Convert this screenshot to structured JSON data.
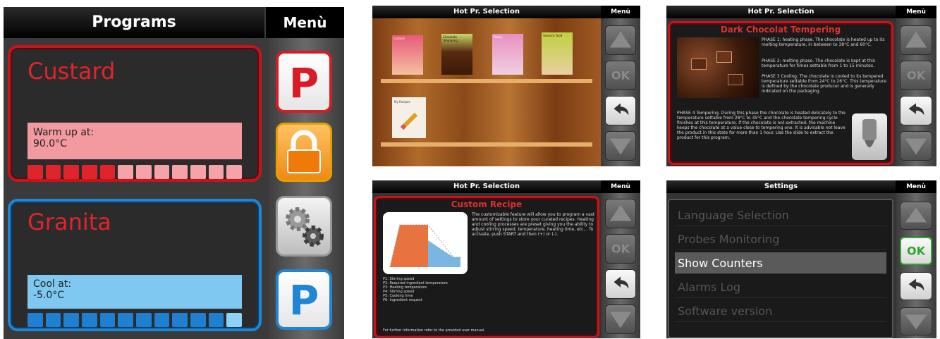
{
  "programs_screen": {
    "title": "Programs",
    "menu_title": "Menù",
    "cards": [
      {
        "name": "Custard",
        "status_label": "Warm up at:",
        "temperature": "90.0°C",
        "color": "#c8131a",
        "progress_filled": 5,
        "progress_total": 12
      },
      {
        "name": "Granita",
        "status_label": "Cool at:",
        "temperature": "-5.0°C",
        "color": "#1f86d6",
        "progress_filled": 11,
        "progress_total": 12
      }
    ],
    "menu_buttons": [
      {
        "icon": "p-icon",
        "label": "P",
        "color": "#d81b24"
      },
      {
        "icon": "lock-icon",
        "label": "",
        "color": "#f08a10"
      },
      {
        "icon": "gears-icon",
        "label": "",
        "color": "#888888"
      },
      {
        "icon": "p-icon",
        "label": "P",
        "color": "#1f86d6"
      }
    ]
  },
  "shelf_screen": {
    "title": "Hot Pr. Selection",
    "menu_title": "Menù",
    "books": [
      "Custard",
      "Chocolate Tempering",
      "Pastry",
      "Savoury Food",
      "My Recipes"
    ],
    "nav_buttons": [
      "up-arrow-icon",
      "OK",
      "back-arrow-icon",
      "down-arrow-icon"
    ]
  },
  "chocolate_screen": {
    "title": "Hot Pr. Selection",
    "menu_title": "Menù",
    "recipe_title": "Dark Chocolat Tempering",
    "phase1": "PHASE 1: heating phase. The chocolate is heated up to its melting temperature, in between to 38°C and 60°C.",
    "phase2": "PHASE 2: melting phase. The chocolate is kept at this temperature for times settable from 1 to 15 minutes.",
    "phase3": "PHASE 3 Cooling. The chocolate is cooled to its tempered temperature settable from 24°C to 26°C. This temperature is defined by the chocolate producer and is generally indicated on the packaging.",
    "phase4": "PHASE 4 Tempering. During this phase the chocolate is heated delicately to the temperature settable from 28°C to 35°C and the chocolate tempering cycle finishes at this temperature. If the chocolate is not extracted, the machine keeps the chocolate at a value close to tempering one. It is advisable not leave the product in this state for more than 1 hour. Use the slide to extract the product for this program."
  },
  "custom_screen": {
    "title": "Hot Pr. Selection",
    "menu_title": "Menù",
    "recipe_title": "Custom Recipe",
    "description": "The customizable feature will allow you to program a vast amount of settings to store your curated recipes. Heating and cooling processes are preset giving you the ability to adjust stirring speed, temperature, heating time, etc... To activate, push START and then (+) or (-).",
    "params": [
      "P1: Stirring speed",
      "P2: Required ingredient temperature",
      "P3: Heating temperature",
      "P4: Stirring speed",
      "P5: Cooking time",
      "P6: Ingredient request"
    ],
    "footer": "For further information refer to the provided user manual."
  },
  "settings_screen": {
    "title": "Settings",
    "menu_title": "Menù",
    "items": [
      "Language Selection",
      "Probes Monitoring",
      "Show Counters",
      "Alarms Log",
      "Software version"
    ],
    "selected_index": 2,
    "ok_color": "#2aa82a"
  }
}
